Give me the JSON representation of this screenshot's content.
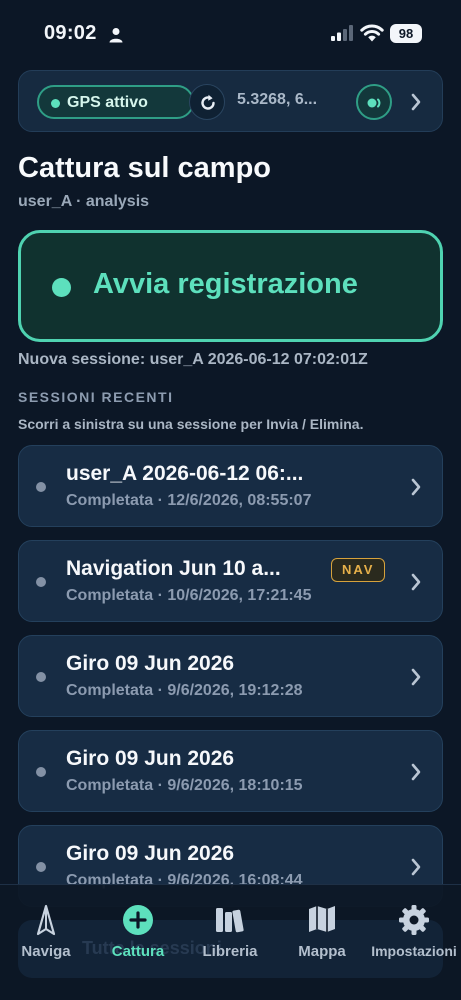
{
  "status_bar": {
    "time": "09:02",
    "battery": "98"
  },
  "gps": {
    "status_label": "GPS attivo",
    "coordinates": "5.3268, 6..."
  },
  "header": {
    "title": "Cattura sul campo",
    "subtitle": "user_A · analysis"
  },
  "record": {
    "label": "Avvia registrazione"
  },
  "new_session": "Nuova sessione: user_A 2026-06-12 07:02:01Z",
  "recent": {
    "header": "SESSIONI RECENTI",
    "hint": "Scorri a sinistra su una sessione per Invia / Elimina."
  },
  "sessions": [
    {
      "title": "user_A 2026-06-12 06:...",
      "meta": "Completata · 12/6/2026, 08:55:07"
    },
    {
      "title": "Navigation Jun 10 a...",
      "meta": "Completata · 10/6/2026, 17:21:45",
      "badge": "NAV"
    },
    {
      "title": "Giro 09 Jun 2026",
      "meta": "Completata · 9/6/2026, 19:12:28"
    },
    {
      "title": "Giro 09 Jun 2026",
      "meta": "Completata · 9/6/2026, 18:10:15"
    },
    {
      "title": "Giro 09 Jun 2026",
      "meta": "Completata · 9/6/2026, 16:08:44"
    }
  ],
  "tabs": [
    {
      "label": "Naviga",
      "icon": "navigation-arrow-icon"
    },
    {
      "label": "Cattura",
      "icon": "plus-circle-icon",
      "active": true
    },
    {
      "label": "Libreria",
      "icon": "books-icon"
    },
    {
      "label": "Mappa",
      "icon": "map-icon"
    },
    {
      "label": "Impostazioni",
      "icon": "gear-icon"
    }
  ],
  "behind_text": "Tutte le sessioni",
  "colors": {
    "accent": "#5de0bd",
    "background": "#0c1726",
    "card": "#172c44",
    "badge": "#e6b04a"
  }
}
